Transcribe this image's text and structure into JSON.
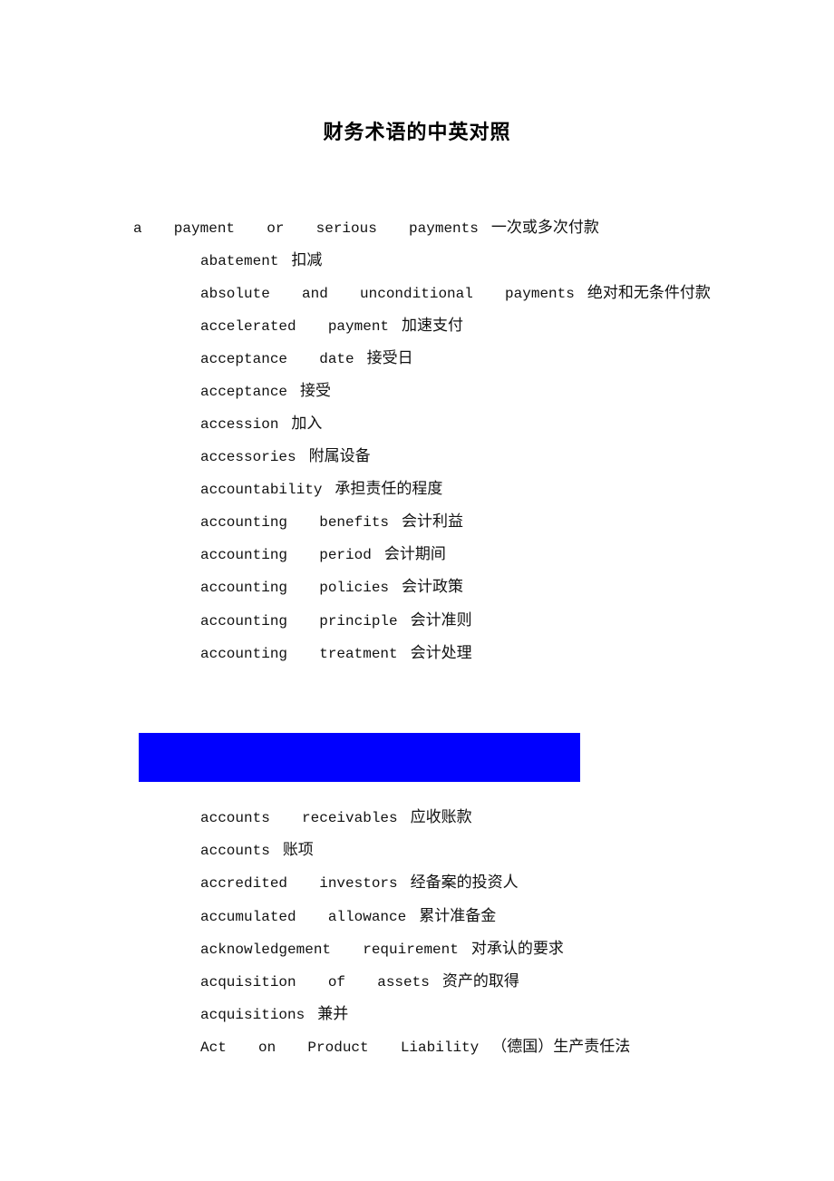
{
  "document": {
    "title": "财务术语的中英对照",
    "highlight_color": "#0000ff",
    "section_1": [
      {
        "en": "a  payment  or  serious  payments",
        "zh": "一次或多次付款"
      },
      {
        "en": "abatement",
        "zh": "扣减"
      },
      {
        "en": "absolute  and  unconditional  payments",
        "zh": "绝对和无条件付款"
      },
      {
        "en": "accelerated  payment",
        "zh": "加速支付"
      },
      {
        "en": "acceptance  date",
        "zh": "接受日"
      },
      {
        "en": "acceptance",
        "zh": "接受"
      },
      {
        "en": "accession",
        "zh": "加入"
      },
      {
        "en": "accessories",
        "zh": "附属设备"
      },
      {
        "en": "accountability",
        "zh": "承担责任的程度"
      },
      {
        "en": "accounting  benefits",
        "zh": "会计利益"
      },
      {
        "en": "accounting  period",
        "zh": "会计期间"
      },
      {
        "en": "accounting  policies",
        "zh": "会计政策"
      },
      {
        "en": "accounting  principle",
        "zh": "会计准则"
      },
      {
        "en": "accounting  treatment",
        "zh": "会计处理"
      }
    ],
    "section_2": [
      {
        "en": "accounts  receivables",
        "zh": "应收账款"
      },
      {
        "en": "accounts",
        "zh": "账项"
      },
      {
        "en": "accredited  investors",
        "zh": "经备案的投资人"
      },
      {
        "en": "accumulated  allowance",
        "zh": "累计准备金"
      },
      {
        "en": "acknowledgement  requirement",
        "zh": "对承认的要求"
      },
      {
        "en": "acquisition  of  assets",
        "zh": "资产的取得"
      },
      {
        "en": "acquisitions",
        "zh": "兼并"
      },
      {
        "en": "Act  on  Product  Liability",
        "zh": "（德国）生产责任法"
      }
    ]
  }
}
